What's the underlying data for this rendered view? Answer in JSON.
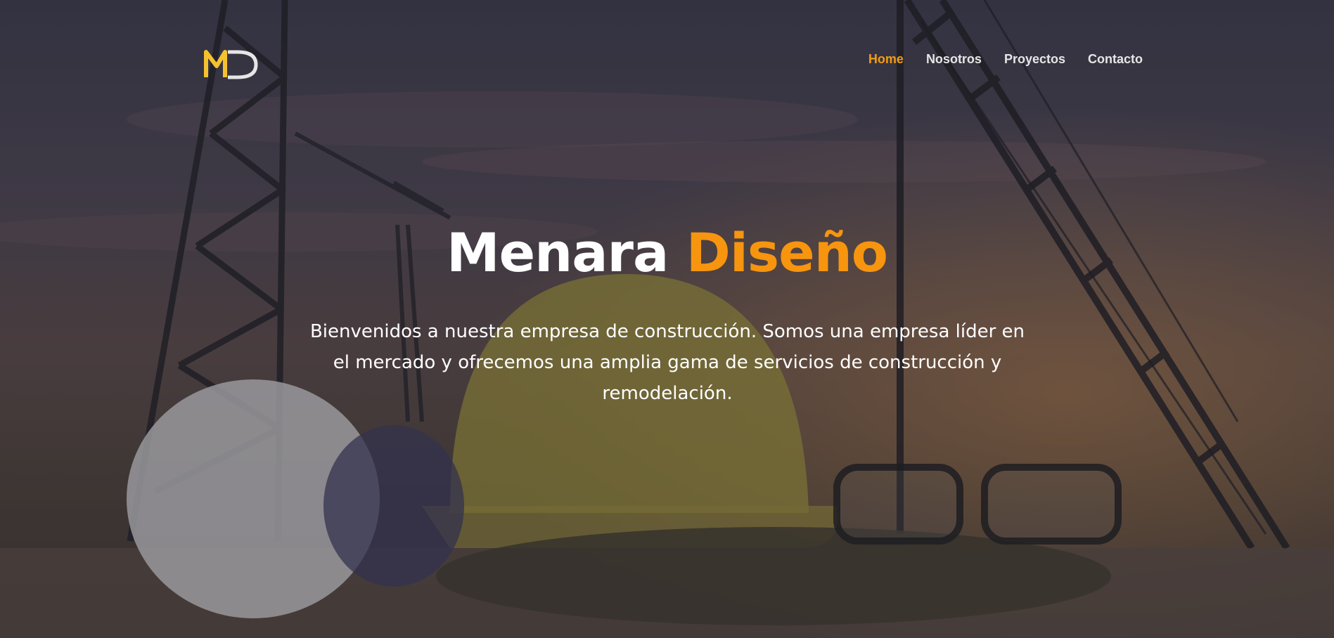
{
  "brand": {
    "logo_text": "MD",
    "accent_color": "#f7950f",
    "logo_color": "#f4c22e"
  },
  "nav": {
    "items": [
      {
        "label": "Home",
        "active": true
      },
      {
        "label": "Nosotros",
        "active": false
      },
      {
        "label": "Proyectos",
        "active": false
      },
      {
        "label": "Contacto",
        "active": false
      }
    ]
  },
  "hero": {
    "title_part1": "Menara",
    "title_part2": "Diseño",
    "description": "Bienvenidos a nuestra empresa de construcción. Somos una empresa líder en el mercado y ofrecemos una amplia gama de servicios de construcción y remodelación."
  }
}
